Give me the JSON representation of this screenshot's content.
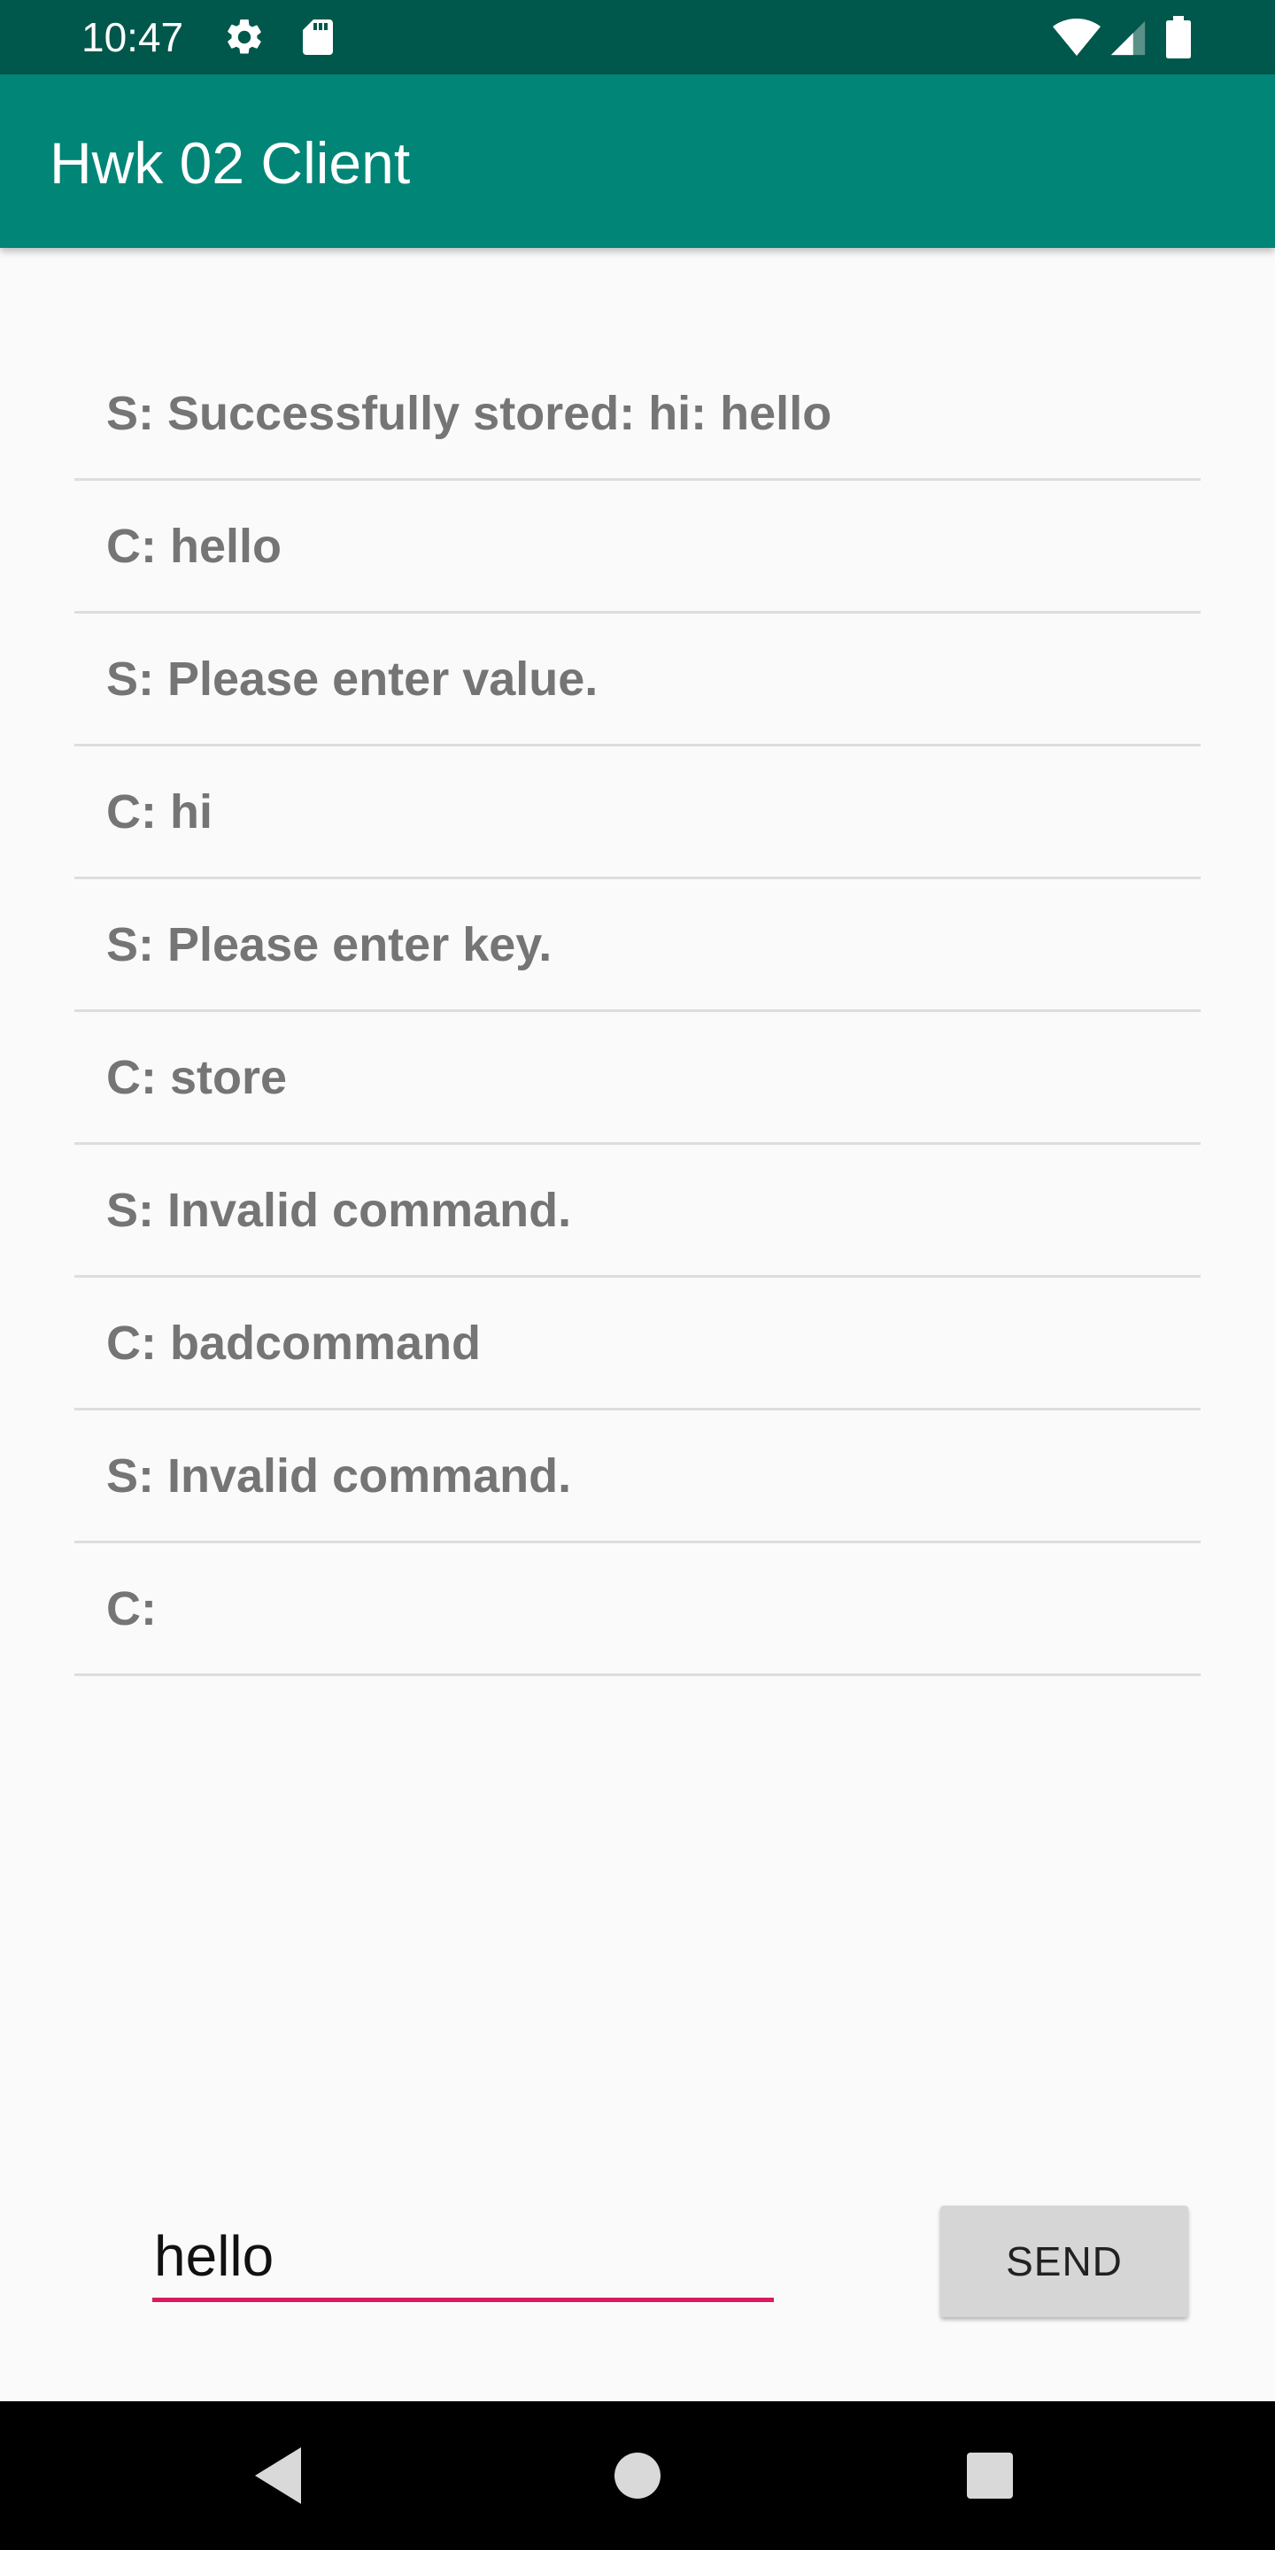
{
  "status_bar": {
    "time": "10:47",
    "icons": [
      "gear-icon",
      "sd-card-icon",
      "wifi-icon",
      "cell-signal-icon",
      "battery-icon"
    ]
  },
  "app_bar": {
    "title": "Hwk 02 Client"
  },
  "messages": [
    {
      "text": "S: Successfully stored: hi: hello"
    },
    {
      "text": "C: hello"
    },
    {
      "text": "S: Please enter value."
    },
    {
      "text": "C: hi"
    },
    {
      "text": "S: Please enter key."
    },
    {
      "text": "C: store"
    },
    {
      "text": "S: Invalid command."
    },
    {
      "text": "C: badcommand"
    },
    {
      "text": "S: Invalid command."
    },
    {
      "text": "C:"
    }
  ],
  "input": {
    "value": "hello",
    "placeholder": ""
  },
  "send_button": {
    "label": "SEND"
  },
  "nav_bar": {
    "icons": [
      "back-icon",
      "home-icon",
      "recents-icon"
    ]
  },
  "colors": {
    "status_bar": "#00574b",
    "app_bar": "#008577",
    "accent": "#d81b60",
    "message_text": "#757575",
    "divider": "#dddddd",
    "background": "#fafafa"
  }
}
